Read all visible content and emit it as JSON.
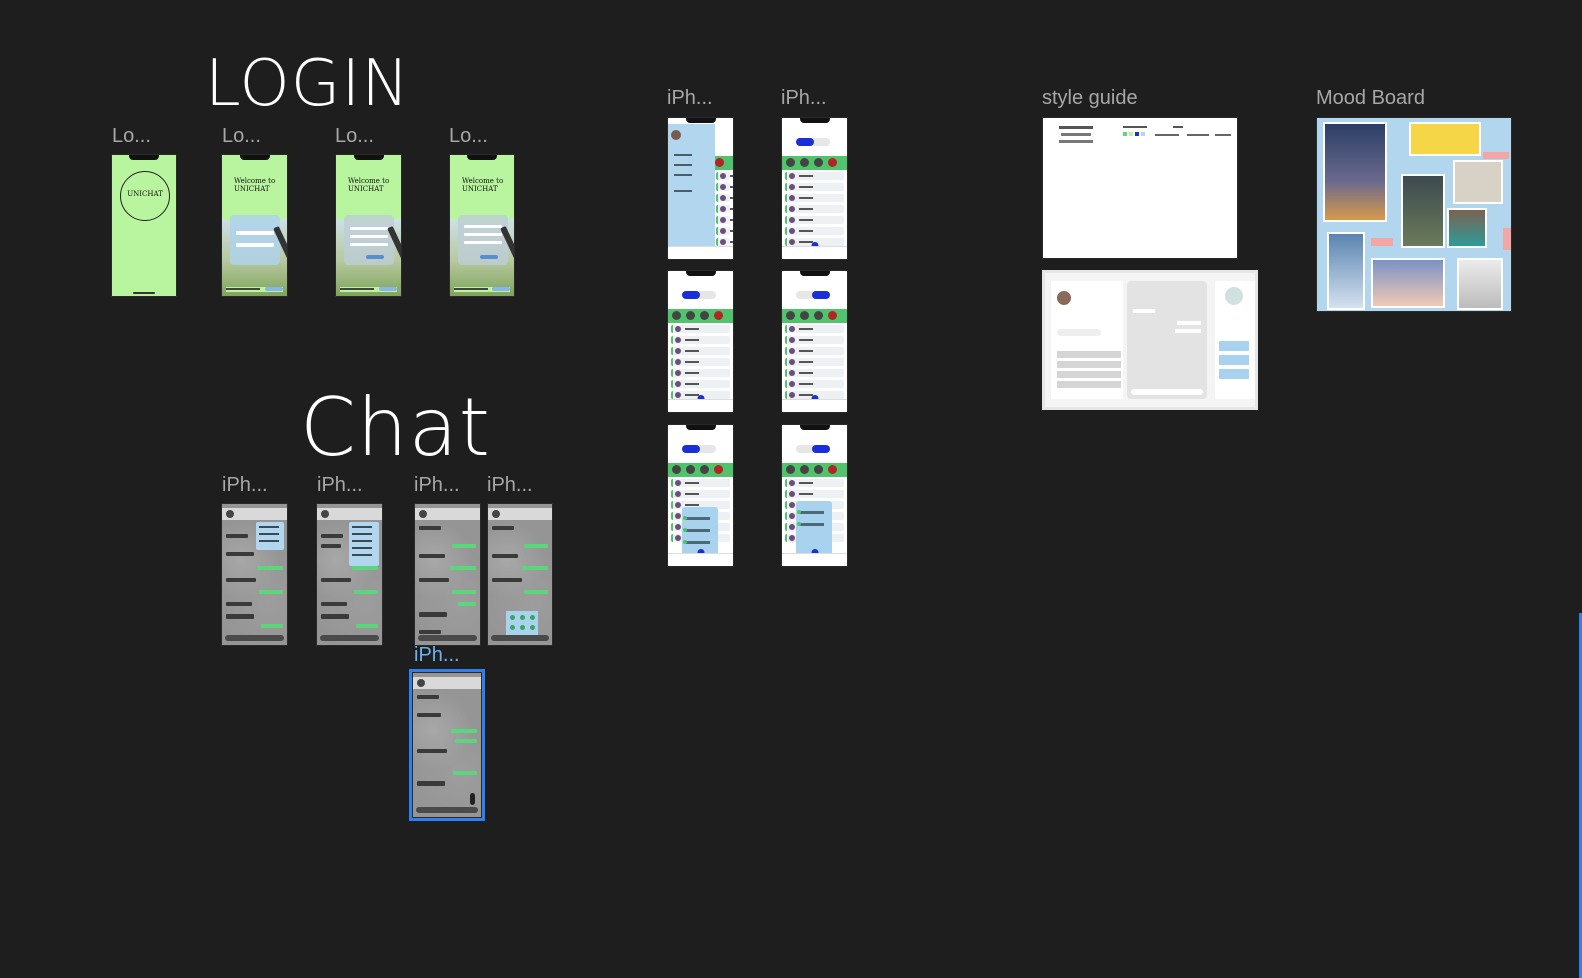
{
  "sections": {
    "login": "LOGIN",
    "chat": "Chat"
  },
  "labels": {
    "login_1": "Lo...",
    "login_2": "Lo...",
    "login_3": "Lo...",
    "login_4": "Lo...",
    "chat_1": "iPh...",
    "chat_2": "iPh...",
    "chat_3": "iPh...",
    "chat_4": "iPh...",
    "chat_5": "iPh...",
    "list_col1": "iPh...",
    "list_col2": "iPh...",
    "style_guide": "style guide",
    "mood_board": "Mood Board"
  },
  "login_screens": {
    "brand": "UNICHAT",
    "welcome": "Welcome to UNICHAT"
  },
  "colors": {
    "canvas": "#1e1e1e",
    "login_green": "#b9f59f",
    "chat_green": "#5cd67a",
    "accent_blue": "#1a2fd8",
    "selection": "#2f80ed",
    "light_blue": "#b3d6ef"
  }
}
